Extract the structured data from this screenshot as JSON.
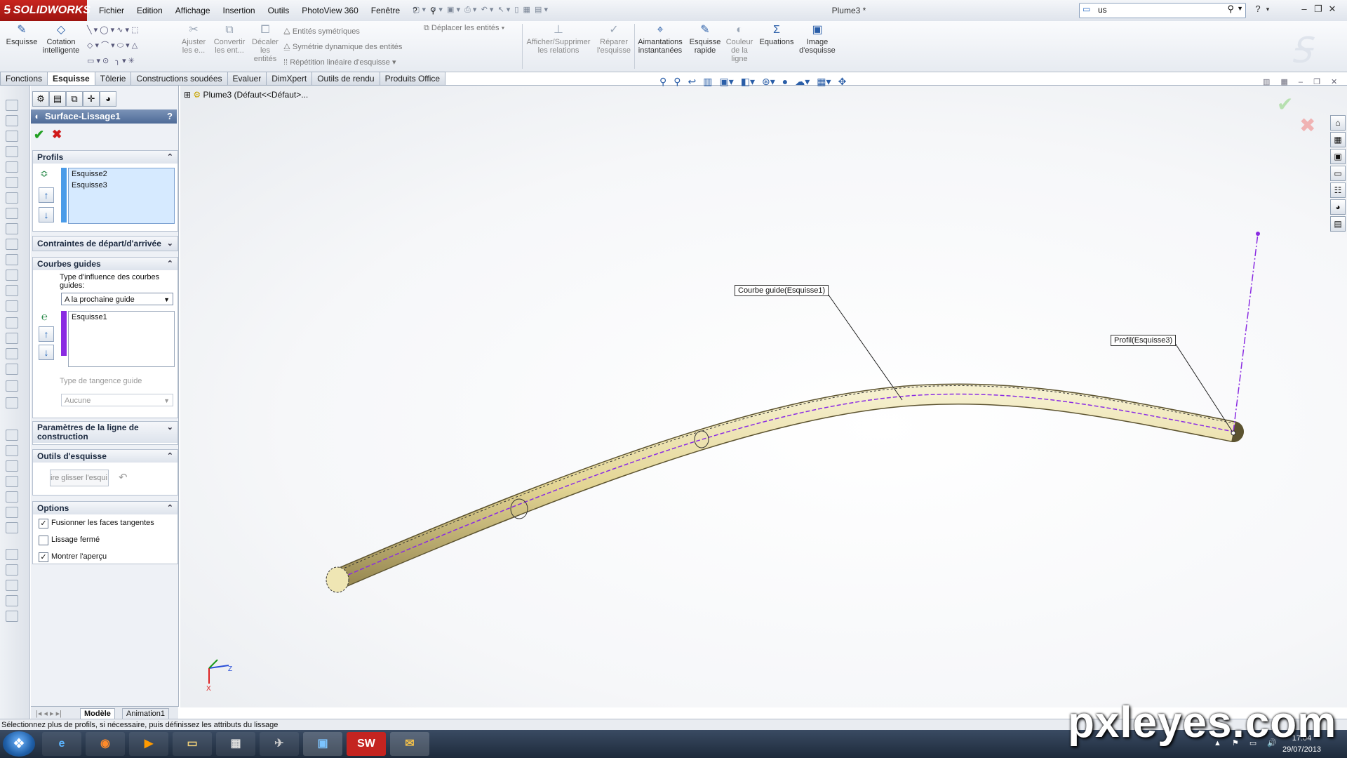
{
  "app": {
    "brand": "SOLIDWORKS",
    "doc_title": "Plume3 *"
  },
  "menus": [
    "Fichier",
    "Edition",
    "Affichage",
    "Insertion",
    "Outils",
    "PhotoView 360",
    "Fenêtre",
    "?"
  ],
  "search": {
    "value": "us"
  },
  "toolbar": {
    "esquisse": "Esquisse",
    "cotation": "Cotation intelligente",
    "ajuster": "Ajuster les e...",
    "convertir": "Convertir les ent...",
    "decaler": "Décaler les entités",
    "entites_symetriques": "Entités symétriques",
    "symetrie_dynamique": "Symétrie dynamique des entités",
    "repetition_lineaire": "Répétition linéaire d'esquisse",
    "deplacer": "Déplacer les entités",
    "afficher_relations": "Afficher/Supprimer les relations",
    "reparer": "Réparer l'esquisse",
    "aimantations": "Aimantations instantanées",
    "esquisse_rapide": "Esquisse rapide",
    "couleur_ligne": "Couleur de la ligne",
    "equations": "Equations",
    "image_esquisse": "Image d'esquisse"
  },
  "tabs": [
    "Fonctions",
    "Esquisse",
    "Tôlerie",
    "Constructions soudées",
    "Evaluer",
    "DimXpert",
    "Outils de rendu",
    "Produits Office"
  ],
  "active_tab": "Esquisse",
  "property_manager": {
    "title": "Surface-Lissage1",
    "help": "?",
    "profils": {
      "title": "Profils",
      "items": [
        "Esquisse2",
        "Esquisse3"
      ]
    },
    "contraintes": {
      "title": "Contraintes de départ/d'arrivée"
    },
    "courbes_guides": {
      "title": "Courbes guides",
      "influence_label": "Type d'influence des courbes guides:",
      "influence_value": "A la prochaine guide",
      "items": [
        "Esquisse1"
      ],
      "tangence_label": "Type de tangence guide",
      "tangence_value": "Aucune"
    },
    "parametres": {
      "title": "Paramètres de la ligne de construction"
    },
    "outils": {
      "title": "Outils d'esquisse",
      "drag_button": "ire glisser l'esqui"
    },
    "options": {
      "title": "Options",
      "items": [
        {
          "label": "Fusionner les faces tangentes",
          "checked": true
        },
        {
          "label": "Lissage fermé",
          "checked": false
        },
        {
          "label": "Montrer l'aperçu",
          "checked": true
        }
      ]
    }
  },
  "model_tabs": [
    "Modèle",
    "Animation1"
  ],
  "tree": {
    "label": "Plume3  (Défaut<<Défaut>..."
  },
  "callouts": {
    "guide": "Courbe guide(Esquisse1)",
    "profil": "Profil(Esquisse3)"
  },
  "status_text": "Sélectionnez plus de profils, si nécessaire, puis définissez les attributs du lissage",
  "clock": {
    "time": "17:04",
    "date": "29/07/2013"
  },
  "watermark": "pxleyes.com",
  "colors": {
    "accent": "#4e6b98",
    "guide_curve": "#8a2be2",
    "surface": "#e9dfa7"
  }
}
